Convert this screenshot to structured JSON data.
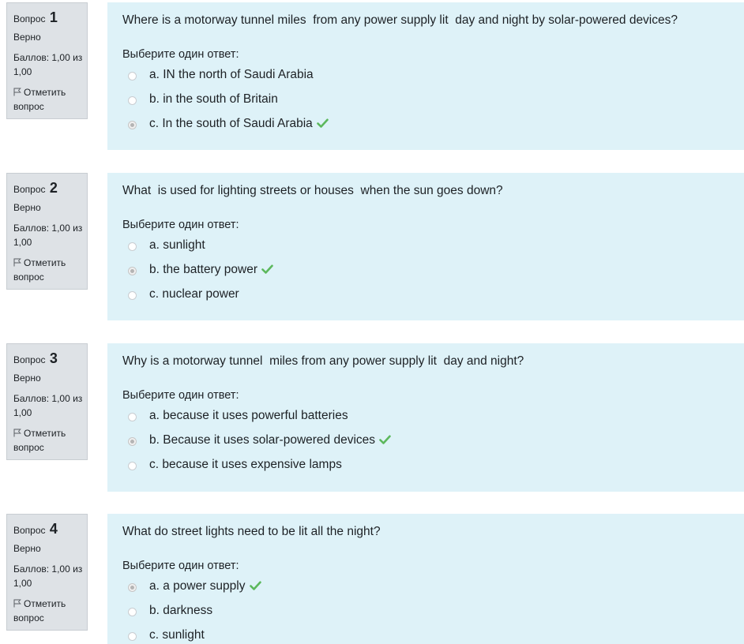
{
  "labels": {
    "question": "Вопрос",
    "state": "Верно",
    "grade": "Баллов: 1,00 из 1,00",
    "flag": "Отметить вопрос",
    "prompt": "Выберите один ответ:"
  },
  "colors": {
    "info_bg": "#dee2e6",
    "content_bg": "#def2f8",
    "correct_tick": "#5cb85c"
  },
  "questions": [
    {
      "number": "1",
      "text": "Where is a motorway tunnel miles  from any power supply lit  day and night by solar-powered devices?",
      "answers": [
        {
          "label": "a. IN the north of Saudi Arabia",
          "selected": false,
          "correct": false
        },
        {
          "label": "b. in the south of Britain",
          "selected": false,
          "correct": false
        },
        {
          "label": "c. In the south of Saudi Arabia",
          "selected": true,
          "correct": true
        }
      ]
    },
    {
      "number": "2",
      "text": "What  is used for lighting streets or houses  when the sun goes down?",
      "answers": [
        {
          "label": "a. sunlight",
          "selected": false,
          "correct": false
        },
        {
          "label": "b. the battery power",
          "selected": true,
          "correct": true
        },
        {
          "label": "c. nuclear power",
          "selected": false,
          "correct": false
        }
      ]
    },
    {
      "number": "3",
      "text": "Why is a motorway tunnel  miles from any power supply lit  day and night?",
      "answers": [
        {
          "label": "a. because it uses powerful batteries",
          "selected": false,
          "correct": false
        },
        {
          "label": "b. Because it uses solar-powered devices",
          "selected": true,
          "correct": true
        },
        {
          "label": "c. because it uses expensive lamps",
          "selected": false,
          "correct": false
        }
      ]
    },
    {
      "number": "4",
      "text": "What do street lights need to be lit all the night?",
      "answers": [
        {
          "label": "a. a power supply",
          "selected": true,
          "correct": true
        },
        {
          "label": "b. darkness",
          "selected": false,
          "correct": false
        },
        {
          "label": "c. sunlight",
          "selected": false,
          "correct": false
        }
      ]
    }
  ]
}
